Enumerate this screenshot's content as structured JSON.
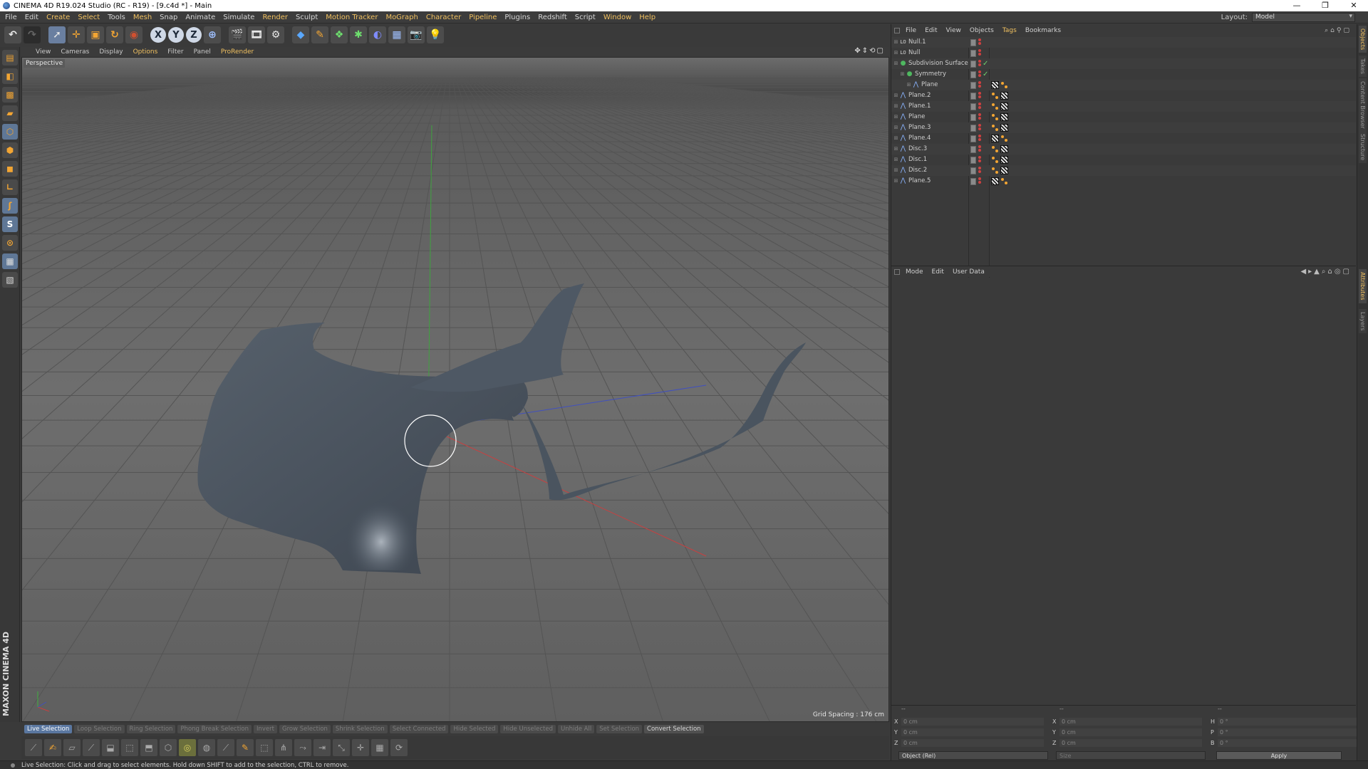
{
  "window": {
    "title": "CINEMA 4D R19.024 Studio (RC - R19) - [9.c4d *] - Main",
    "controls": [
      "—",
      "❐",
      "✕"
    ]
  },
  "menubar": {
    "items": [
      "File",
      "Edit",
      "Create",
      "Select",
      "Tools",
      "Mesh",
      "Snap",
      "Animate",
      "Simulate",
      "Render",
      "Sculpt",
      "Motion Tracker",
      "MoGraph",
      "Character",
      "Pipeline",
      "Plugins",
      "Redshift",
      "Script",
      "Window",
      "Help"
    ],
    "layout_label": "Layout:",
    "layout_value": "Model"
  },
  "toolbar": {
    "undo_icon": "undo-icon",
    "redo_icon": "redo-icon",
    "x_label": "X",
    "y_label": "Y",
    "z_label": "Z"
  },
  "viewport": {
    "menu": [
      "View",
      "Cameras",
      "Display",
      "Options",
      "Filter",
      "Panel",
      "ProRender"
    ],
    "camera_label": "Perspective",
    "grid_spacing": "Grid Spacing : 176 cm",
    "bg_top": "#7a7a7a",
    "bg_bottom": "#5a5a5a",
    "model_color": "#4e5864",
    "axis_x_color": "#c84040",
    "axis_y_color": "#40b040",
    "axis_z_color": "#4050c0"
  },
  "mode_strip": {
    "items": [
      "Live Selection",
      "Loop Selection",
      "Ring Selection",
      "Phong Break Selection",
      "Invert",
      "Grow Selection",
      "Shrink Selection",
      "Select Connected",
      "Hide Selected",
      "Hide Unselected",
      "Unhide All",
      "Set Selection",
      "Convert Selection"
    ]
  },
  "statusbar": {
    "text": "Live Selection: Click and drag to select elements. Hold down SHIFT to add to the selection, CTRL to remove."
  },
  "object_manager": {
    "menu": [
      "File",
      "Edit",
      "View",
      "Objects",
      "Tags",
      "Bookmarks"
    ],
    "objects": [
      {
        "name": "Null.1",
        "indent": 0,
        "icon": "null-icon",
        "tags": []
      },
      {
        "name": "Null",
        "indent": 0,
        "icon": "null-icon",
        "tags": []
      },
      {
        "name": "Subdivision Surface",
        "indent": 0,
        "icon": "subdivision-icon",
        "tags": [],
        "check": "✓"
      },
      {
        "name": "Symmetry",
        "indent": 1,
        "icon": "symmetry-icon",
        "tags": [],
        "check": "✓"
      },
      {
        "name": "Plane",
        "indent": 2,
        "icon": "polygon-icon",
        "tags": [
          "checker",
          "dots"
        ]
      },
      {
        "name": "Plane.2",
        "indent": 0,
        "icon": "polygon-icon",
        "tags": [
          "dots",
          "checker"
        ]
      },
      {
        "name": "Plane.1",
        "indent": 0,
        "icon": "polygon-icon",
        "tags": [
          "dots",
          "checker"
        ]
      },
      {
        "name": "Plane",
        "indent": 0,
        "icon": "polygon-icon",
        "tags": [
          "dots",
          "checker"
        ]
      },
      {
        "name": "Plane.3",
        "indent": 0,
        "icon": "polygon-icon",
        "tags": [
          "dots",
          "checker"
        ]
      },
      {
        "name": "Plane.4",
        "indent": 0,
        "icon": "polygon-icon",
        "tags": [
          "checker",
          "dots"
        ]
      },
      {
        "name": "Disc.3",
        "indent": 0,
        "icon": "polygon-icon",
        "tags": [
          "dots",
          "checker"
        ]
      },
      {
        "name": "Disc.1",
        "indent": 0,
        "icon": "polygon-icon",
        "tags": [
          "dots",
          "checker"
        ]
      },
      {
        "name": "Disc.2",
        "indent": 0,
        "icon": "polygon-icon",
        "tags": [
          "dots",
          "checker"
        ]
      },
      {
        "name": "Plane.5",
        "indent": 0,
        "icon": "polygon-icon",
        "tags": [
          "checker",
          "dots"
        ]
      }
    ]
  },
  "attribute_manager": {
    "menu": [
      "Mode",
      "Edit",
      "User Data"
    ]
  },
  "side_tabs": [
    "Objects",
    "Takes",
    "Content Browser",
    "Structure",
    "Attributes",
    "Layers"
  ],
  "coordinates": {
    "header": [
      "--",
      "--",
      "--"
    ],
    "rows": [
      {
        "a1": "X",
        "v1": "0 cm",
        "a2": "X",
        "v2": "0 cm",
        "a3": "H",
        "v3": "0 °"
      },
      {
        "a1": "Y",
        "v1": "0 cm",
        "a2": "Y",
        "v2": "0 cm",
        "a3": "P",
        "v3": "0 °"
      },
      {
        "a1": "Z",
        "v1": "0 cm",
        "a2": "Z",
        "v2": "0 cm",
        "a3": "B",
        "v3": "0 °"
      }
    ],
    "mode_select": "Object (Rel)",
    "size_select": "Size",
    "apply_label": "Apply"
  },
  "brand": "MAXON CINEMA 4D"
}
